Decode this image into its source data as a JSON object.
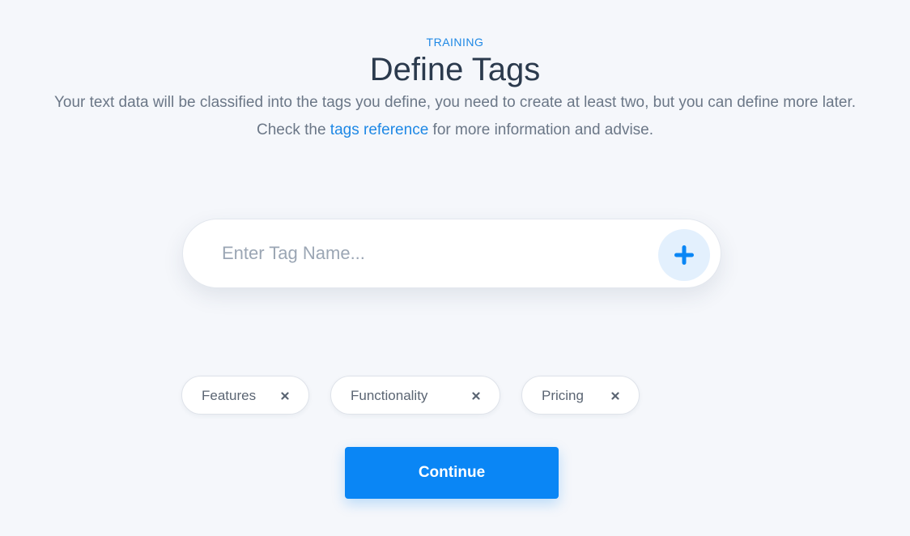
{
  "header": {
    "eyebrow": "TRAINING",
    "title": "Define Tags",
    "description_before": "Your text data will be classified into the tags you define, you need to create at least two, but you can define more later. Check the ",
    "description_link": "tags reference",
    "description_after": " for more information and advise."
  },
  "tag_input": {
    "placeholder": "Enter Tag Name...",
    "value": "",
    "add_icon": "plus-icon"
  },
  "tags": [
    {
      "label": "Features",
      "remove_icon": "close-icon"
    },
    {
      "label": "Functionality",
      "remove_icon": "close-icon"
    },
    {
      "label": "Pricing",
      "remove_icon": "close-icon"
    }
  ],
  "actions": {
    "continue_label": "Continue"
  },
  "colors": {
    "accent": "#0a86f5",
    "link": "#1e88e5",
    "heading": "#2b3a4d",
    "body_text": "#6b7787",
    "background": "#f5f7fb",
    "add_button_bg": "#e3f0fd"
  }
}
